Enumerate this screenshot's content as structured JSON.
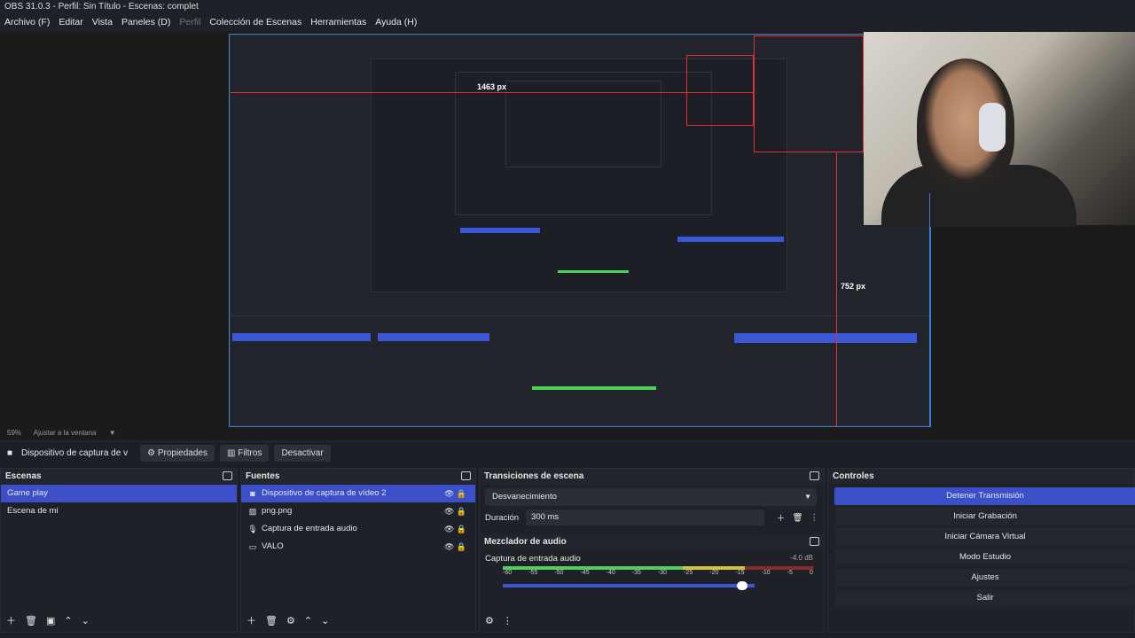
{
  "window": {
    "title": "OBS 31.0.3 - Perfil: Sin Título - Escenas: complet"
  },
  "menu": [
    {
      "label": "Archivo (F)",
      "dim": false
    },
    {
      "label": "Editar",
      "dim": false
    },
    {
      "label": "Vista",
      "dim": false
    },
    {
      "label": "Paneles (D)",
      "dim": false
    },
    {
      "label": "Perfil",
      "dim": true
    },
    {
      "label": "Colección de Escenas",
      "dim": false
    },
    {
      "label": "Herramientas",
      "dim": false
    },
    {
      "label": "Ayuda (H)",
      "dim": false
    }
  ],
  "preview": {
    "measure_width": "1463 px",
    "measure_height": "752 px"
  },
  "zoom": {
    "percent": "59%",
    "fit_label": "Ajustar a la ventana"
  },
  "source_toolbar": {
    "source_name": "Dispositivo de captura de v",
    "properties": "Propiedades",
    "filters": "Filtros",
    "deactivate": "Desactivar"
  },
  "scenes": {
    "title": "Escenas",
    "items": [
      {
        "label": "Game play",
        "selected": true
      },
      {
        "label": "Escena de mi",
        "selected": false
      }
    ]
  },
  "sources": {
    "title": "Fuentes",
    "items": [
      {
        "label": "Dispositivo de captura de vídeo 2",
        "icon": "camera-icon",
        "selected": true
      },
      {
        "label": "png.png",
        "icon": "image-icon",
        "selected": false
      },
      {
        "label": "Captura de entrada audio",
        "icon": "mic-icon",
        "selected": false
      },
      {
        "label": "VALO",
        "icon": "monitor-icon",
        "selected": false
      }
    ]
  },
  "transitions": {
    "title": "Transiciones de escena",
    "selected": "Desvanecimiento",
    "duration_label": "Duración",
    "duration_value": "300 ms"
  },
  "mixer": {
    "title": "Mezclador de audio",
    "channel": "Captura de entrada audio",
    "db": "-4.0 dB",
    "ticks": [
      "-60",
      "-55",
      "-50",
      "-45",
      "-40",
      "-35",
      "-30",
      "-25",
      "-20",
      "-15",
      "-10",
      "-5",
      "0"
    ],
    "volume_fraction": 0.97
  },
  "controls": {
    "title": "Controles",
    "buttons": [
      {
        "label": "Detener Transmisión",
        "active": true
      },
      {
        "label": "Iniciar Grabación",
        "active": false
      },
      {
        "label": "Iniciar Cámara Virtual",
        "active": false
      },
      {
        "label": "Modo Estudio",
        "active": false
      },
      {
        "label": "Ajustes",
        "active": false
      },
      {
        "label": "Salir",
        "active": false
      }
    ]
  }
}
